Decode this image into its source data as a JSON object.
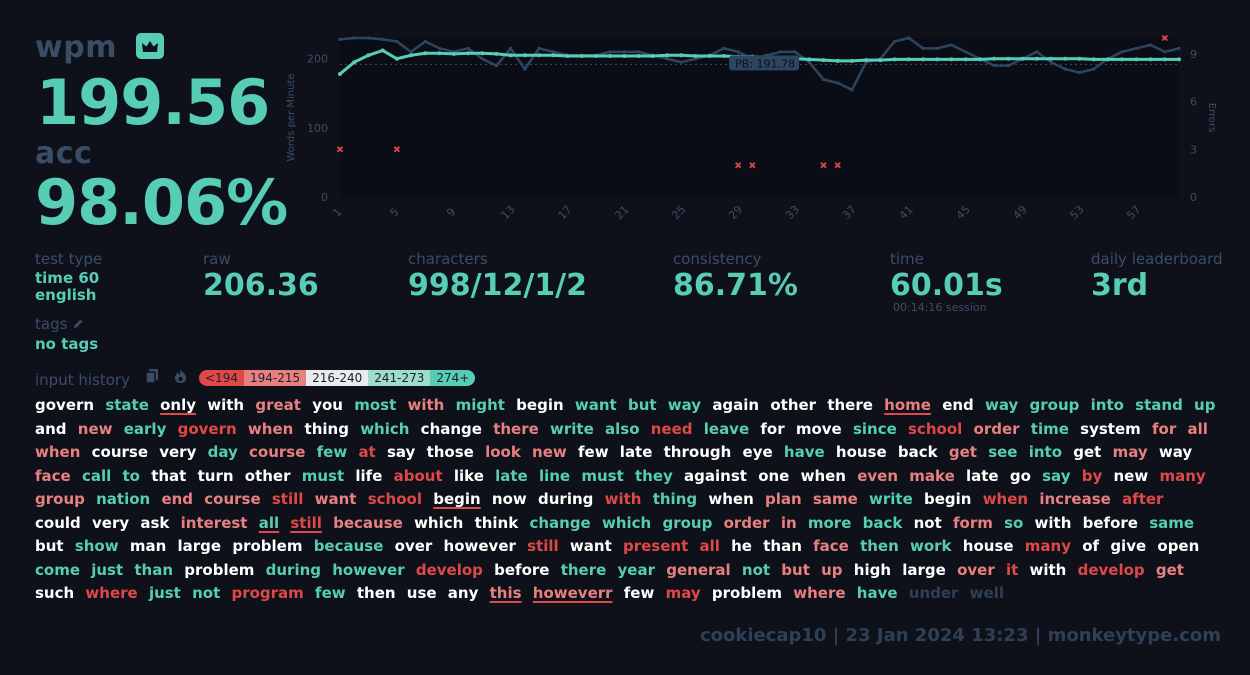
{
  "summary": {
    "wpm_label": "wpm",
    "wpm": "199.56",
    "acc_label": "acc",
    "acc": "98.06%"
  },
  "info": {
    "test_type_label": "test type",
    "mode": "time 60",
    "language": "english",
    "tags_label": "tags",
    "tags_value": "no tags"
  },
  "stats": {
    "raw_label": "raw",
    "raw": "206.36",
    "characters_label": "characters",
    "characters": "998/12/1/2",
    "consistency_label": "consistency",
    "consistency": "86.71%",
    "time_label": "time",
    "time": "60.01s",
    "session": "00:14:16 session",
    "leaderboard_label": "daily leaderboard",
    "leaderboard": "3rd"
  },
  "history": {
    "label": "input history",
    "legend": [
      "<194",
      "194-215",
      "216-240",
      "241-273",
      "274+"
    ]
  },
  "footer": {
    "text": "cookiecap10 | 23 Jan 2024 13:23 | monkeytype.com"
  },
  "colors": {
    "accent": "#57cdb6",
    "error": "#e04848",
    "background": "#0e111a",
    "sub": "#3b4d66"
  },
  "chart_data": {
    "type": "line",
    "ylabel": "Words per Minute",
    "y2label": "Errors",
    "ylim": [
      0,
      230
    ],
    "y2lim": [
      0,
      10
    ],
    "yticks": [
      0,
      100,
      200
    ],
    "y2ticks": [
      0,
      3,
      6,
      9
    ],
    "x": [
      1,
      2,
      3,
      4,
      5,
      6,
      7,
      8,
      9,
      10,
      11,
      12,
      13,
      14,
      15,
      16,
      17,
      18,
      19,
      20,
      21,
      22,
      23,
      24,
      25,
      26,
      27,
      28,
      29,
      30,
      31,
      32,
      33,
      34,
      35,
      36,
      37,
      38,
      39,
      40,
      41,
      42,
      43,
      44,
      45,
      46,
      47,
      48,
      49,
      50,
      51,
      52,
      53,
      54,
      55,
      56,
      57,
      58,
      59,
      60
    ],
    "xticks": [
      1,
      5,
      9,
      13,
      17,
      21,
      25,
      29,
      33,
      37,
      41,
      45,
      49,
      53,
      57
    ],
    "pb_label": "PB: 191.78",
    "pb": 191.78,
    "series": [
      {
        "name": "wpm",
        "values": [
          178,
          195,
          205,
          212,
          200,
          205,
          208,
          208,
          207,
          208,
          208,
          207,
          205,
          205,
          205,
          205,
          204,
          204,
          204,
          204,
          204,
          204,
          204,
          205,
          205,
          204,
          204,
          204,
          203,
          203,
          202,
          201,
          200,
          199,
          198,
          197,
          197,
          198,
          198,
          199,
          199,
          199,
          199,
          199,
          199,
          199,
          200,
          200,
          200,
          200,
          200,
          200,
          200,
          199,
          199,
          199,
          199,
          199,
          199,
          199
        ]
      },
      {
        "name": "raw",
        "values": [
          228,
          230,
          230,
          228,
          225,
          210,
          225,
          215,
          210,
          215,
          200,
          190,
          215,
          185,
          215,
          210,
          205,
          205,
          205,
          210,
          210,
          210,
          205,
          200,
          195,
          200,
          205,
          215,
          210,
          200,
          205,
          210,
          210,
          195,
          170,
          165,
          155,
          195,
          200,
          225,
          230,
          215,
          215,
          220,
          210,
          200,
          190,
          190,
          200,
          210,
          195,
          185,
          180,
          185,
          200,
          210,
          215,
          220,
          210,
          215
        ]
      }
    ],
    "errors": [
      {
        "x": 1,
        "y": 3
      },
      {
        "x": 5,
        "y": 3
      },
      {
        "x": 29,
        "y": 2
      },
      {
        "x": 30,
        "y": 2
      },
      {
        "x": 35,
        "y": 2
      },
      {
        "x": 36,
        "y": 2
      },
      {
        "x": 59,
        "y": 10
      }
    ]
  },
  "words": [
    {
      "t": "govern",
      "c": "wh"
    },
    {
      "t": "state",
      "c": "ok"
    },
    {
      "t": "only",
      "c": "wh",
      "u": true
    },
    {
      "t": "with",
      "c": "wh"
    },
    {
      "t": "great",
      "c": "pk"
    },
    {
      "t": "you",
      "c": "wh"
    },
    {
      "t": "most",
      "c": "ok"
    },
    {
      "t": "with",
      "c": "pk"
    },
    {
      "t": "might",
      "c": "ok"
    },
    {
      "t": "begin",
      "c": "wh"
    },
    {
      "t": "want",
      "c": "ok"
    },
    {
      "t": "but",
      "c": "ok"
    },
    {
      "t": "way",
      "c": "ok"
    },
    {
      "t": "again",
      "c": "wh"
    },
    {
      "t": "other",
      "c": "wh"
    },
    {
      "t": "there",
      "c": "wh"
    },
    {
      "t": "home",
      "c": "pk",
      "u": true
    },
    {
      "t": "end",
      "c": "wh"
    },
    {
      "t": "way",
      "c": "ok"
    },
    {
      "t": "group",
      "c": "ok"
    },
    {
      "t": "into",
      "c": "ok"
    },
    {
      "t": "stand",
      "c": "ok"
    },
    {
      "t": "up",
      "c": "ok"
    },
    {
      "t": "and",
      "c": "wh"
    },
    {
      "t": "new",
      "c": "pk"
    },
    {
      "t": "early",
      "c": "ok"
    },
    {
      "t": "govern",
      "c": "err"
    },
    {
      "t": "when",
      "c": "pk"
    },
    {
      "t": "thing",
      "c": "wh"
    },
    {
      "t": "which",
      "c": "ok"
    },
    {
      "t": "change",
      "c": "wh"
    },
    {
      "t": "there",
      "c": "pk"
    },
    {
      "t": "write",
      "c": "ok"
    },
    {
      "t": "also",
      "c": "ok"
    },
    {
      "t": "need",
      "c": "err"
    },
    {
      "t": "leave",
      "c": "ok"
    },
    {
      "t": "for",
      "c": "wh"
    },
    {
      "t": "move",
      "c": "wh"
    },
    {
      "t": "since",
      "c": "ok"
    },
    {
      "t": "school",
      "c": "err"
    },
    {
      "t": "order",
      "c": "pk"
    },
    {
      "t": "time",
      "c": "ok"
    },
    {
      "t": "system",
      "c": "wh"
    },
    {
      "t": "for",
      "c": "pk"
    },
    {
      "t": "all",
      "c": "pk"
    },
    {
      "t": "when",
      "c": "pk"
    },
    {
      "t": "course",
      "c": "wh"
    },
    {
      "t": "very",
      "c": "wh"
    },
    {
      "t": "day",
      "c": "ok"
    },
    {
      "t": "course",
      "c": "pk"
    },
    {
      "t": "few",
      "c": "ok"
    },
    {
      "t": "at",
      "c": "err"
    },
    {
      "t": "say",
      "c": "wh"
    },
    {
      "t": "those",
      "c": "wh"
    },
    {
      "t": "look",
      "c": "pk"
    },
    {
      "t": "new",
      "c": "pk"
    },
    {
      "t": "few",
      "c": "wh"
    },
    {
      "t": "late",
      "c": "wh"
    },
    {
      "t": "through",
      "c": "wh"
    },
    {
      "t": "eye",
      "c": "wh"
    },
    {
      "t": "have",
      "c": "ok"
    },
    {
      "t": "house",
      "c": "wh"
    },
    {
      "t": "back",
      "c": "wh"
    },
    {
      "t": "get",
      "c": "pk"
    },
    {
      "t": "see",
      "c": "ok"
    },
    {
      "t": "into",
      "c": "ok"
    },
    {
      "t": "get",
      "c": "wh"
    },
    {
      "t": "may",
      "c": "pk"
    },
    {
      "t": "way",
      "c": "wh"
    },
    {
      "t": "face",
      "c": "pk"
    },
    {
      "t": "call",
      "c": "ok"
    },
    {
      "t": "to",
      "c": "ok"
    },
    {
      "t": "that",
      "c": "wh"
    },
    {
      "t": "turn",
      "c": "wh"
    },
    {
      "t": "other",
      "c": "wh"
    },
    {
      "t": "must",
      "c": "ok"
    },
    {
      "t": "life",
      "c": "wh"
    },
    {
      "t": "about",
      "c": "err"
    },
    {
      "t": "like",
      "c": "wh"
    },
    {
      "t": "late",
      "c": "ok"
    },
    {
      "t": "line",
      "c": "ok"
    },
    {
      "t": "must",
      "c": "ok"
    },
    {
      "t": "they",
      "c": "ok"
    },
    {
      "t": "against",
      "c": "wh"
    },
    {
      "t": "one",
      "c": "wh"
    },
    {
      "t": "when",
      "c": "wh"
    },
    {
      "t": "even",
      "c": "pk"
    },
    {
      "t": "make",
      "c": "pk"
    },
    {
      "t": "late",
      "c": "wh"
    },
    {
      "t": "go",
      "c": "wh"
    },
    {
      "t": "say",
      "c": "ok"
    },
    {
      "t": "by",
      "c": "err"
    },
    {
      "t": "new",
      "c": "wh"
    },
    {
      "t": "many",
      "c": "err"
    },
    {
      "t": "group",
      "c": "pk"
    },
    {
      "t": "nation",
      "c": "ok"
    },
    {
      "t": "end",
      "c": "pk"
    },
    {
      "t": "course",
      "c": "pk"
    },
    {
      "t": "still",
      "c": "err"
    },
    {
      "t": "want",
      "c": "pk"
    },
    {
      "t": "school",
      "c": "err"
    },
    {
      "t": "begin",
      "c": "wh",
      "u": true
    },
    {
      "t": "now",
      "c": "wh"
    },
    {
      "t": "during",
      "c": "wh"
    },
    {
      "t": "with",
      "c": "err"
    },
    {
      "t": "thing",
      "c": "ok"
    },
    {
      "t": "when",
      "c": "wh"
    },
    {
      "t": "plan",
      "c": "pk"
    },
    {
      "t": "same",
      "c": "pk"
    },
    {
      "t": "write",
      "c": "ok"
    },
    {
      "t": "begin",
      "c": "wh"
    },
    {
      "t": "when",
      "c": "err"
    },
    {
      "t": "increase",
      "c": "pk"
    },
    {
      "t": "after",
      "c": "err"
    },
    {
      "t": "could",
      "c": "wh"
    },
    {
      "t": "very",
      "c": "wh"
    },
    {
      "t": "ask",
      "c": "wh"
    },
    {
      "t": "interest",
      "c": "pk"
    },
    {
      "t": "all",
      "c": "ok",
      "u": true
    },
    {
      "t": "still",
      "c": "err",
      "u": true
    },
    {
      "t": "because",
      "c": "pk"
    },
    {
      "t": "which",
      "c": "wh"
    },
    {
      "t": "think",
      "c": "wh"
    },
    {
      "t": "change",
      "c": "ok"
    },
    {
      "t": "which",
      "c": "ok"
    },
    {
      "t": "group",
      "c": "ok"
    },
    {
      "t": "order",
      "c": "pk"
    },
    {
      "t": "in",
      "c": "pk"
    },
    {
      "t": "more",
      "c": "ok"
    },
    {
      "t": "back",
      "c": "ok"
    },
    {
      "t": "not",
      "c": "wh"
    },
    {
      "t": "form",
      "c": "pk"
    },
    {
      "t": "so",
      "c": "ok"
    },
    {
      "t": "with",
      "c": "wh"
    },
    {
      "t": "before",
      "c": "wh"
    },
    {
      "t": "same",
      "c": "ok"
    },
    {
      "t": "but",
      "c": "wh"
    },
    {
      "t": "show",
      "c": "ok"
    },
    {
      "t": "man",
      "c": "wh"
    },
    {
      "t": "large",
      "c": "wh"
    },
    {
      "t": "problem",
      "c": "wh"
    },
    {
      "t": "because",
      "c": "ok"
    },
    {
      "t": "over",
      "c": "wh"
    },
    {
      "t": "however",
      "c": "wh"
    },
    {
      "t": "still",
      "c": "err"
    },
    {
      "t": "want",
      "c": "wh"
    },
    {
      "t": "present",
      "c": "err"
    },
    {
      "t": "all",
      "c": "err"
    },
    {
      "t": "he",
      "c": "wh"
    },
    {
      "t": "than",
      "c": "wh"
    },
    {
      "t": "face",
      "c": "pk"
    },
    {
      "t": "then",
      "c": "ok"
    },
    {
      "t": "work",
      "c": "ok"
    },
    {
      "t": "house",
      "c": "wh"
    },
    {
      "t": "many",
      "c": "err"
    },
    {
      "t": "of",
      "c": "wh"
    },
    {
      "t": "give",
      "c": "wh"
    },
    {
      "t": "open",
      "c": "wh"
    },
    {
      "t": "come",
      "c": "ok"
    },
    {
      "t": "just",
      "c": "ok"
    },
    {
      "t": "than",
      "c": "ok"
    },
    {
      "t": "problem",
      "c": "wh"
    },
    {
      "t": "during",
      "c": "ok"
    },
    {
      "t": "however",
      "c": "ok"
    },
    {
      "t": "develop",
      "c": "err"
    },
    {
      "t": "before",
      "c": "wh"
    },
    {
      "t": "there",
      "c": "ok"
    },
    {
      "t": "year",
      "c": "ok"
    },
    {
      "t": "general",
      "c": "pk"
    },
    {
      "t": "not",
      "c": "ok"
    },
    {
      "t": "but",
      "c": "pk"
    },
    {
      "t": "up",
      "c": "pk"
    },
    {
      "t": "high",
      "c": "wh"
    },
    {
      "t": "large",
      "c": "wh"
    },
    {
      "t": "over",
      "c": "pk"
    },
    {
      "t": "it",
      "c": "err"
    },
    {
      "t": "with",
      "c": "wh"
    },
    {
      "t": "develop",
      "c": "err"
    },
    {
      "t": "get",
      "c": "pk"
    },
    {
      "t": "such",
      "c": "wh"
    },
    {
      "t": "where",
      "c": "err"
    },
    {
      "t": "just",
      "c": "ok"
    },
    {
      "t": "not",
      "c": "ok"
    },
    {
      "t": "program",
      "c": "err"
    },
    {
      "t": "few",
      "c": "ok"
    },
    {
      "t": "then",
      "c": "wh"
    },
    {
      "t": "use",
      "c": "wh"
    },
    {
      "t": "any",
      "c": "wh"
    },
    {
      "t": "this",
      "c": "pk",
      "u": true
    },
    {
      "t": "howeverr",
      "c": "pk",
      "u": true
    },
    {
      "t": "few",
      "c": "wh"
    },
    {
      "t": "may",
      "c": "err"
    },
    {
      "t": "problem",
      "c": "wh"
    },
    {
      "t": "where",
      "c": "pk"
    },
    {
      "t": "have",
      "c": "ok"
    },
    {
      "t": "under",
      "c": "dim"
    },
    {
      "t": "well",
      "c": "dim"
    }
  ]
}
